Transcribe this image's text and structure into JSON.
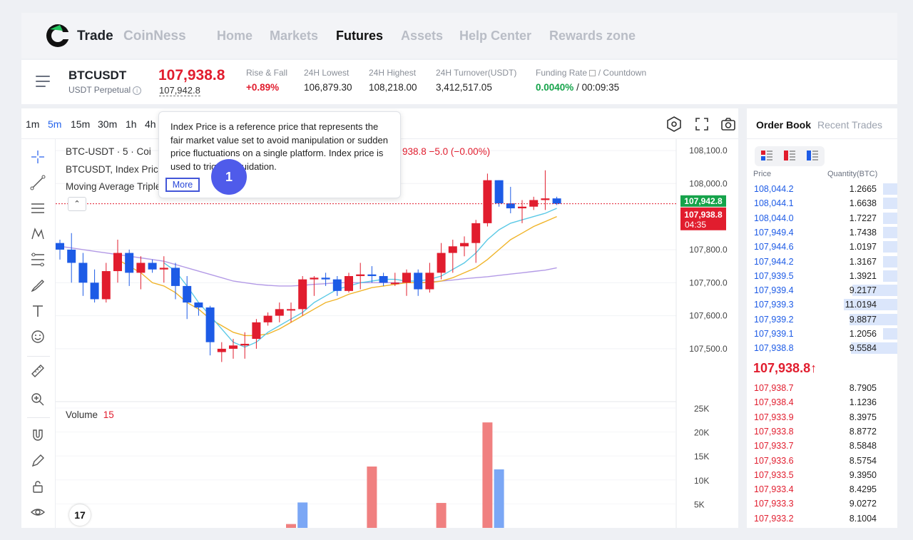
{
  "brand": {
    "name": "Trade",
    "sub": "CoinNess",
    "logo_icon": "coinness-logo-icon"
  },
  "nav": {
    "items": [
      "Home",
      "Markets",
      "Futures",
      "Assets",
      "Help Center",
      "Rewards zone"
    ],
    "active": "Futures"
  },
  "ticker": {
    "symbol": "BTCUSDT",
    "subtitle": "USDT Perpetual",
    "last_price": "107,938.8",
    "index_price": "107,942.8",
    "rise_fall_label": "Rise & Fall",
    "rise_fall": "+0.89%",
    "low_label": "24H Lowest",
    "low": "106,879.30",
    "high_label": "24H Highest",
    "high": "108,218.00",
    "turnover_label": "24H Turnover(USDT)",
    "turnover": "3,412,517.05",
    "funding_label": "Funding Rate",
    "countdown_label": "/ Countdown",
    "funding_rate": "0.0040%",
    "countdown": "/ 00:09:35"
  },
  "timeframes": [
    "1m",
    "5m",
    "15m",
    "30m",
    "1h",
    "4h"
  ],
  "active_timeframe": "5m",
  "chart_legend": {
    "line1": "BTC-USDT · 5 · Coi",
    "ohlc_tail": "938.8 −5.0 (−0.00%)",
    "line2": "BTCUSDT, Index Price",
    "line3": "Moving Average Triple",
    "volume_label": "Volume",
    "volume_value": "15"
  },
  "price_axis": [
    "108,100.0",
    "108,000.0",
    "107,800.0",
    "107,700.0",
    "107,600.0",
    "107,500.0"
  ],
  "volume_axis": [
    "25K",
    "20K",
    "15K",
    "10K",
    "5K"
  ],
  "price_tags": {
    "index": "107,942.8",
    "last": "107,938.8",
    "timer": "04:35"
  },
  "tooltip": {
    "text": "Index Price is a reference price that represents the fair market value set to avoid manipulation or sudden price fluctuations on a single platform. Index price is used to trigger liquidation.",
    "more": "More",
    "step": "1"
  },
  "orderbook": {
    "tabs": [
      "Order Book",
      "Recent Trades"
    ],
    "price_header": "Price",
    "qty_header": "Quantity(BTC)",
    "asks": [
      [
        "108,044.2",
        "1.2665"
      ],
      [
        "108,044.1",
        "1.6638"
      ],
      [
        "108,044.0",
        "1.7227"
      ],
      [
        "107,949.4",
        "1.7438"
      ],
      [
        "107,944.6",
        "1.0197"
      ],
      [
        "107,944.2",
        "1.3167"
      ],
      [
        "107,939.5",
        "1.3921"
      ],
      [
        "107,939.4",
        "9.2177"
      ],
      [
        "107,939.3",
        "11.0194"
      ],
      [
        "107,939.2",
        "9.8877"
      ],
      [
        "107,939.1",
        "1.2056"
      ],
      [
        "107,938.8",
        "9.5584"
      ]
    ],
    "mid_price": "107,938.8↑",
    "bids": [
      [
        "107,938.7",
        "8.7905"
      ],
      [
        "107,938.4",
        "1.1236"
      ],
      [
        "107,933.9",
        "8.3975"
      ],
      [
        "107,933.8",
        "8.8772"
      ],
      [
        "107,933.7",
        "8.5848"
      ],
      [
        "107,933.6",
        "8.5754"
      ],
      [
        "107,933.5",
        "9.3950"
      ],
      [
        "107,933.4",
        "8.4295"
      ],
      [
        "107,933.3",
        "9.0272"
      ],
      [
        "107,933.2",
        "8.1004"
      ]
    ]
  },
  "colors": {
    "up": "#e11d2e",
    "down": "#1d5be6",
    "ask": "#1d5be6",
    "bid": "#e11d2e",
    "ma_fast": "#5bc9e6",
    "ma_mid": "#f0b429",
    "ma_slow": "#b39ae6"
  },
  "chart_data": {
    "type": "candlestick",
    "ylim": [
      107420,
      108115
    ],
    "candles": [
      [
        107820,
        107800,
        107830,
        107770
      ],
      [
        107800,
        107760,
        107850,
        107700
      ],
      [
        107760,
        107700,
        107790,
        107660
      ],
      [
        107700,
        107650,
        107740,
        107640
      ],
      [
        107650,
        107735,
        107760,
        107640
      ],
      [
        107735,
        107790,
        107830,
        107700
      ],
      [
        107790,
        107730,
        107800,
        107690
      ],
      [
        107730,
        107760,
        107780,
        107680
      ],
      [
        107760,
        107740,
        107770,
        107730
      ],
      [
        107740,
        107745,
        107780,
        107700
      ],
      [
        107745,
        107690,
        107760,
        107650
      ],
      [
        107690,
        107640,
        107720,
        107590
      ],
      [
        107640,
        107625,
        107640,
        107600
      ],
      [
        107625,
        107520,
        107630,
        107480
      ],
      [
        107490,
        107500,
        107520,
        107460
      ],
      [
        107500,
        107510,
        107530,
        107470
      ],
      [
        107510,
        107515,
        107550,
        107470
      ],
      [
        107530,
        107580,
        107590,
        107500
      ],
      [
        107580,
        107600,
        107610,
        107570
      ],
      [
        107600,
        107620,
        107640,
        107580
      ],
      [
        107620,
        107620,
        107640,
        107580
      ],
      [
        107620,
        107710,
        107720,
        107600
      ],
      [
        107710,
        107715,
        107720,
        107660
      ],
      [
        107715,
        107710,
        107730,
        107690
      ],
      [
        107710,
        107675,
        107720,
        107660
      ],
      [
        107675,
        107720,
        107730,
        107670
      ],
      [
        107720,
        107725,
        107760,
        107680
      ],
      [
        107725,
        107720,
        107750,
        107700
      ],
      [
        107720,
        107700,
        107730,
        107690
      ],
      [
        107700,
        107700,
        107730,
        107690
      ],
      [
        107700,
        107730,
        107740,
        107660
      ],
      [
        107730,
        107680,
        107740,
        107660
      ],
      [
        107680,
        107730,
        107760,
        107670
      ],
      [
        107730,
        107790,
        107820,
        107710
      ],
      [
        107790,
        107810,
        107830,
        107730
      ],
      [
        107810,
        107820,
        107840,
        107780
      ],
      [
        107820,
        107880,
        107890,
        107760
      ],
      [
        107880,
        108010,
        108030,
        107870
      ],
      [
        108010,
        107940,
        108010,
        107930
      ],
      [
        107940,
        107925,
        107990,
        107910
      ],
      [
        107925,
        107930,
        107950,
        107880
      ],
      [
        107930,
        107950,
        107960,
        107920
      ],
      [
        107950,
        107955,
        108040,
        107920
      ],
      [
        107955,
        107939,
        107960,
        107935
      ]
    ],
    "ma_fast": [
      null,
      null,
      null,
      null,
      null,
      null,
      null,
      null,
      null,
      107760,
      107735,
      107690,
      107640,
      107600,
      107560,
      107520,
      107505,
      107520,
      107550,
      107570,
      107590,
      107610,
      107640,
      107660,
      107680,
      107690,
      107700,
      107705,
      107710,
      107710,
      107705,
      107705,
      107710,
      107720,
      107740,
      107760,
      107790,
      107830,
      107860,
      107880,
      107890,
      107900,
      107910,
      107925
    ],
    "ma_mid": [
      null,
      null,
      null,
      null,
      null,
      107770,
      107750,
      107730,
      107700,
      107690,
      107670,
      107640,
      107620,
      107590,
      107570,
      107550,
      107540,
      107540,
      107545,
      107560,
      107580,
      107600,
      107620,
      107640,
      107650,
      107665,
      107675,
      107685,
      107690,
      107695,
      107700,
      107700,
      107700,
      107705,
      107715,
      107730,
      107745,
      107770,
      107800,
      107830,
      107850,
      107870,
      107885,
      107900
    ],
    "ma_slow": [
      107810,
      107805,
      107800,
      107795,
      107790,
      107785,
      107780,
      107775,
      107770,
      107765,
      107755,
      107745,
      107735,
      107725,
      107715,
      107705,
      107700,
      107695,
      107692,
      107690,
      107690,
      107692,
      107695,
      107697,
      107700,
      107700,
      107700,
      107700,
      107700,
      107700,
      107700,
      107700,
      107702,
      107705,
      107708,
      107712,
      107715,
      107718,
      107722,
      107726,
      107730,
      107734,
      107738,
      107745
    ],
    "volume_axis_max": 25000,
    "volume": [
      [
        21,
        5300,
        "down"
      ],
      [
        27,
        12800,
        "up"
      ],
      [
        33,
        5200,
        "up"
      ],
      [
        37,
        22000,
        "up"
      ],
      [
        38,
        12200,
        "down"
      ]
    ]
  }
}
